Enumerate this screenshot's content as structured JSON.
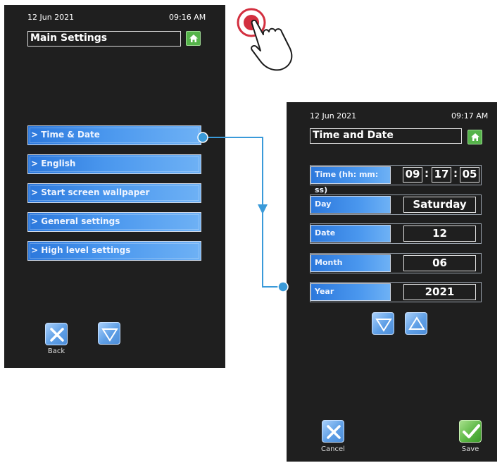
{
  "screen1": {
    "date": "12 Jun 2021",
    "time": "09:16 AM",
    "title": "Main Settings",
    "menu": [
      {
        "label": "> Time & Date"
      },
      {
        "label": "> English"
      },
      {
        "label": "> Start screen wallpaper"
      },
      {
        "label": "> General settings"
      },
      {
        "label": "> High level settings"
      }
    ],
    "back_label": "Back"
  },
  "screen2": {
    "date": "12 Jun 2021",
    "time": "09:17 AM",
    "title": "Time and Date",
    "time_row": {
      "label": "Time (hh: mm: ss)",
      "hh": "09",
      "mm": "17",
      "ss": "05",
      "sep": ":"
    },
    "day_row": {
      "label": "Day",
      "value": "Saturday"
    },
    "date_row": {
      "label": "Date",
      "value": "12"
    },
    "month_row": {
      "label": "Month",
      "value": "06"
    },
    "year_row": {
      "label": "Year",
      "value": "2021"
    },
    "cancel_label": "Cancel",
    "save_label": "Save"
  },
  "colors": {
    "screen_bg": "#1f1f1f",
    "accent_blue": "#2c78dc",
    "connector": "#3a9ad9",
    "save_green": "#58b541",
    "touch_red": "#d32f3f"
  },
  "icons": [
    "home-icon",
    "close-icon",
    "chevron-down-icon",
    "chevron-up-icon",
    "check-icon",
    "touch-hand-icon"
  ]
}
